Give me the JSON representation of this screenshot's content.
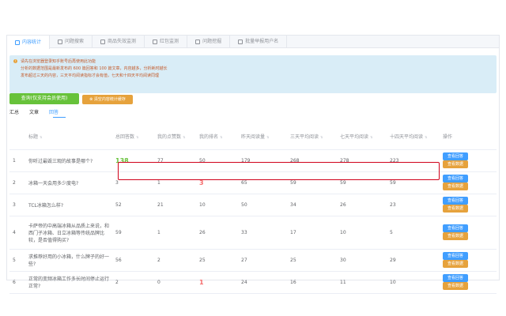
{
  "tabs": [
    {
      "label": "内容统计",
      "icon": "chart-icon"
    },
    {
      "label": "问题搜索",
      "icon": "search-icon"
    },
    {
      "label": "商品失效监测",
      "icon": "monitor-icon"
    },
    {
      "label": "红包监测",
      "icon": "gift-icon"
    },
    {
      "label": "问题挖掘",
      "icon": "dig-icon"
    },
    {
      "label": "批量举报用户名",
      "icon": "report-icon"
    }
  ],
  "alert": {
    "lines": [
      "请先在浏览器登录知乎账号后再使用此功能",
      "分析的数据范围是最新发布的 600 篇回答和 100 篇文章，内容越多，分析耗时越长",
      "发布超过三天的内容，三天平均阅读指标才会有值，七天和十四天平均阅读同理"
    ]
  },
  "buttons": {
    "query": "查询(仅支持会员使用)",
    "clear": "清空内容统计缓存"
  },
  "subtabs": [
    "汇总",
    "文章",
    "回答"
  ],
  "table": {
    "headers": [
      "标题",
      "总回答数",
      "我的点赞数",
      "我的排名",
      "昨天阅读量",
      "三天平均阅读",
      "七天平均阅读",
      "十四天平均阅读",
      "操作"
    ],
    "view_answer": "查看回答",
    "view_data": "查看数据",
    "rows": [
      {
        "idx": "1",
        "title": "你听过最毁三观的故事是哪个?",
        "total": "138",
        "likes": "77",
        "rank": "50",
        "yesterday": "179",
        "avg3": "268",
        "avg7": "278",
        "avg14": "223"
      },
      {
        "idx": "2",
        "title": "冰箱一天会用多少度电?",
        "total": "3",
        "likes": "1",
        "rank": "3",
        "yesterday": "65",
        "avg3": "59",
        "avg7": "59",
        "avg14": "59"
      },
      {
        "idx": "3",
        "title": "TCL冰箱怎么样?",
        "total": "52",
        "likes": "21",
        "rank": "10",
        "yesterday": "50",
        "avg3": "34",
        "avg7": "26",
        "avg14": "23"
      },
      {
        "idx": "4",
        "title": "卡萨帝的中高端冰箱从品质上来说，和西门子冰箱、日立冰箱等传统品牌比较，是否值得购买?",
        "total": "59",
        "likes": "1",
        "rank": "26",
        "yesterday": "33",
        "avg3": "17",
        "avg7": "10",
        "avg14": "5"
      },
      {
        "idx": "5",
        "title": "求推荐好用的小冰箱，什么牌子的好一些?",
        "total": "56",
        "likes": "2",
        "rank": "25",
        "yesterday": "27",
        "avg3": "25",
        "avg7": "30",
        "avg14": "29"
      },
      {
        "idx": "6",
        "title": "正常的变频冰箱工作多长时间停止运行正常?",
        "total": "2",
        "likes": "0",
        "rank": "1",
        "yesterday": "24",
        "avg3": "16",
        "avg7": "11",
        "avg14": "10"
      }
    ]
  },
  "colors": {
    "accent": "#409eff",
    "green": "#67c23a",
    "red": "#f56c6c",
    "orange": "#e6a23c",
    "highlight_box": "#d0021b"
  }
}
